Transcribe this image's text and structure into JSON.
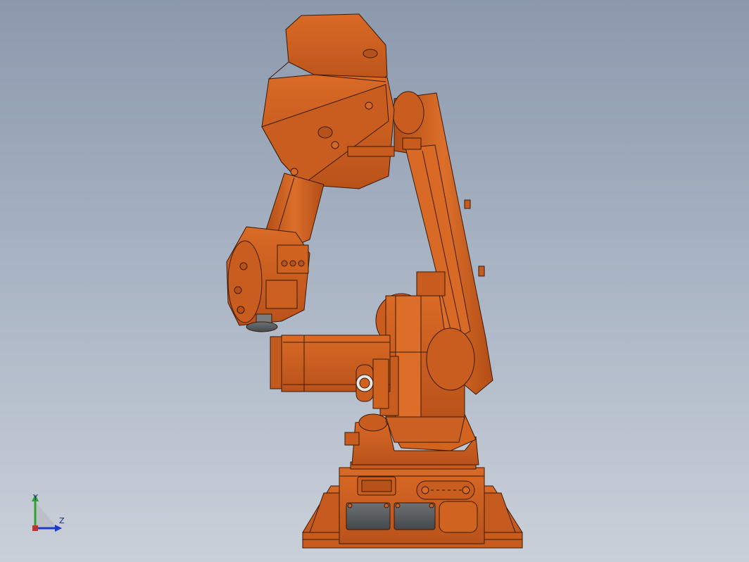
{
  "viewport": {
    "background_top": "#8c99ad",
    "background_bottom": "#c9d0d9",
    "model_name": "",
    "model_color": "#d0611f",
    "edge_color": "#3a1a08",
    "dark_part_color": "#5b5e61"
  },
  "triad": {
    "y_label": "Y",
    "z_label": "Z",
    "y_color": "#2fa52f",
    "z_color": "#1b3bcf"
  }
}
